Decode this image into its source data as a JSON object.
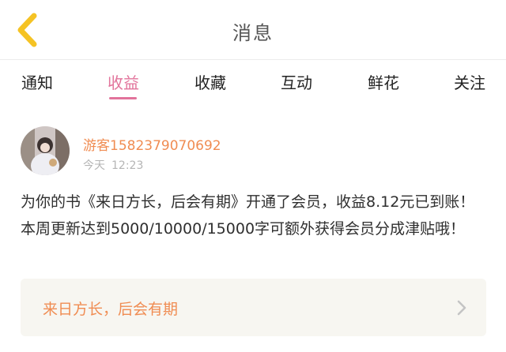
{
  "header": {
    "title": "消息",
    "back_icon": "chevron-left-icon",
    "back_icon_color": "#f5c324"
  },
  "tabs": [
    {
      "label": "通知",
      "active": false
    },
    {
      "label": "收益",
      "active": true
    },
    {
      "label": "收藏",
      "active": false
    },
    {
      "label": "互动",
      "active": false
    },
    {
      "label": "鲜花",
      "active": false
    },
    {
      "label": "关注",
      "active": false
    }
  ],
  "message": {
    "sender": "游客1582379070692",
    "date": "今天",
    "time": "12:23",
    "body": "为你的书《来日方长，后会有期》开通了会员，收益8.12元已到账！本周更新达到5000/10000/15000字可额外获得会员分成津贴哦！",
    "book_title": "来日方长，后会有期",
    "link_icon": "chevron-right-icon"
  },
  "colors": {
    "accent": "#e2739b",
    "name_orange": "#f08c52",
    "card_bg": "#f7f6f1"
  }
}
